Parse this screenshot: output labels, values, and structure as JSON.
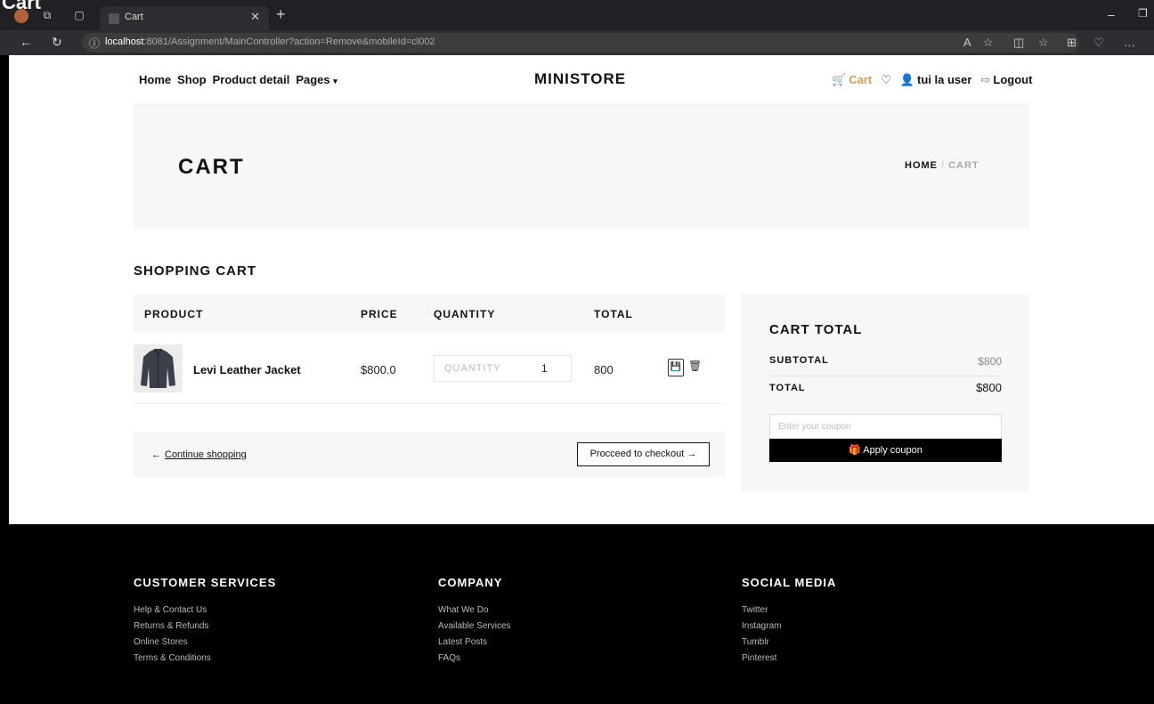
{
  "window_overlay_title": "Cart",
  "browser": {
    "tab_title": "Cart",
    "url_host": "localhost",
    "url_rest": ":8081/Assignment/MainController?action=Remove&mobileId=cl002"
  },
  "nav": {
    "home": "Home",
    "shop": "Shop",
    "product_detail": "Product detail",
    "pages": "Pages",
    "logo": "MINISTORE",
    "cart": "Cart",
    "user": "tui la user",
    "logout": "Logout"
  },
  "hero": {
    "title": "CART",
    "crumb_home": "HOME",
    "crumb_sep": "/",
    "crumb_current": "CART"
  },
  "cart": {
    "section_title": "SHOPPING CART",
    "headers": {
      "product": "PRODUCT",
      "price": "PRICE",
      "quantity": "QUANTITY",
      "total": "TOTAL"
    },
    "items": [
      {
        "name": "Levi Leather Jacket",
        "price": "$800.0",
        "quantity_placeholder": "QUANTITY",
        "quantity": "1",
        "total": "800"
      }
    ],
    "continue_shopping": "Continue shopping",
    "checkout": "Procceed to checkout"
  },
  "totals": {
    "title": "CART TOTAL",
    "subtotal_label": "SUBTOTAL",
    "subtotal_value": "$800",
    "total_label": "TOTAL",
    "total_value": "$800",
    "coupon_placeholder": "Enter your coupon",
    "apply_coupon": "Apply coupon"
  },
  "footer": {
    "customer_services": {
      "title": "CUSTOMER SERVICES",
      "links": [
        "Help & Contact Us",
        "Returns & Refunds",
        "Online Stores",
        "Terms & Conditions"
      ]
    },
    "company": {
      "title": "COMPANY",
      "links": [
        "What We Do",
        "Available Services",
        "Latest Posts",
        "FAQs"
      ]
    },
    "social": {
      "title": "SOCIAL MEDIA",
      "links": [
        "Twitter",
        "Instagram",
        "Tumblr",
        "Pinterest"
      ]
    }
  },
  "colors": {
    "accent": "#d4a04d",
    "panel": "#f6f7f8",
    "footer_bg": "#000000"
  }
}
